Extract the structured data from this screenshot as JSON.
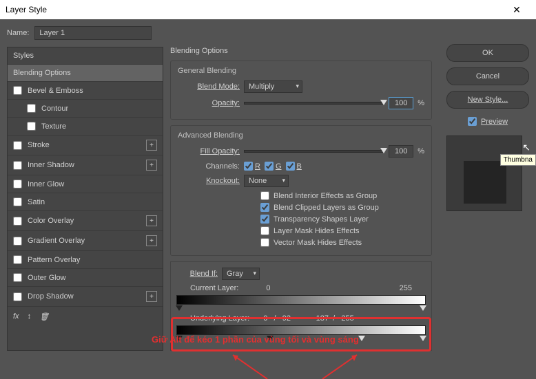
{
  "title": "Layer Style",
  "name_label": "Name:",
  "name_value": "Layer 1",
  "styles": {
    "header": "Styles",
    "items": [
      {
        "label": "Blending Options",
        "selected": true,
        "checkbox": false,
        "plus": false,
        "indent": false
      },
      {
        "label": "Bevel & Emboss",
        "checkbox": true,
        "plus": false,
        "indent": false
      },
      {
        "label": "Contour",
        "checkbox": true,
        "plus": false,
        "indent": true
      },
      {
        "label": "Texture",
        "checkbox": true,
        "plus": false,
        "indent": true
      },
      {
        "label": "Stroke",
        "checkbox": true,
        "plus": true,
        "indent": false
      },
      {
        "label": "Inner Shadow",
        "checkbox": true,
        "plus": true,
        "indent": false
      },
      {
        "label": "Inner Glow",
        "checkbox": true,
        "plus": false,
        "indent": false
      },
      {
        "label": "Satin",
        "checkbox": true,
        "plus": false,
        "indent": false
      },
      {
        "label": "Color Overlay",
        "checkbox": true,
        "plus": true,
        "indent": false
      },
      {
        "label": "Gradient Overlay",
        "checkbox": true,
        "plus": true,
        "indent": false
      },
      {
        "label": "Pattern Overlay",
        "checkbox": true,
        "plus": false,
        "indent": false
      },
      {
        "label": "Outer Glow",
        "checkbox": true,
        "plus": false,
        "indent": false
      },
      {
        "label": "Drop Shadow",
        "checkbox": true,
        "plus": true,
        "indent": false
      }
    ],
    "footer_fx": "fx",
    "footer_arrows": "↕"
  },
  "center": {
    "title": "Blending Options",
    "general": {
      "title": "General Blending",
      "blend_mode_label": "Blend Mode:",
      "blend_mode_value": "Multiply",
      "opacity_label": "Opacity:",
      "opacity_value": "100",
      "opacity_unit": "%"
    },
    "advanced": {
      "title": "Advanced Blending",
      "fill_label": "Fill Opacity:",
      "fill_value": "100",
      "fill_unit": "%",
      "channels_label": "Channels:",
      "ch_r": "R",
      "ch_g": "G",
      "ch_b": "B",
      "knockout_label": "Knockout:",
      "knockout_value": "None",
      "chk1": "Blend Interior Effects as Group",
      "chk2": "Blend Clipped Layers as Group",
      "chk3": "Transparency Shapes Layer",
      "chk4": "Layer Mask Hides Effects",
      "chk5": "Vector Mask Hides Effects"
    },
    "blendif": {
      "label": "Blend If:",
      "value": "Gray",
      "current_label": "Current Layer:",
      "current_low": "0",
      "current_high": "255",
      "under_label": "Underlying Layer:",
      "under_vals": "0   /   92            187  /   255"
    }
  },
  "right": {
    "ok": "OK",
    "cancel": "Cancel",
    "newstyle": "New Style...",
    "preview": "Preview"
  },
  "tooltip": "Thumbna",
  "annotation": "Giữ Alt để kéo 1 phần của vùng tối và vùng sáng"
}
